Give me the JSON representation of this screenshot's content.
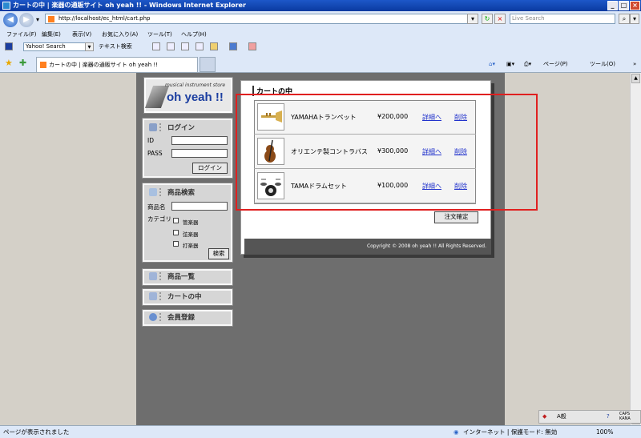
{
  "window": {
    "title": "カートの中 | 楽器の通販サイト oh yeah !! - Windows Internet Explorer",
    "minimize": "_",
    "maximize": "□",
    "close": "×"
  },
  "address_bar": {
    "url": "http://localhost/ec_html/cart.php",
    "search_placeholder": "Live Search"
  },
  "menu": {
    "file": "ファイル(F)",
    "edit": "編集(E)",
    "view": "表示(V)",
    "favorites": "お気に入り(A)",
    "tools": "ツール(T)",
    "help": "ヘルプ(H)"
  },
  "toolbar": {
    "yahoo_search": "Yahoo! Search",
    "text_search": "テキスト検索"
  },
  "tab": {
    "label": "カートの中 | 楽器の通販サイト oh yeah !!"
  },
  "command_bar": {
    "page": "ページ(P)",
    "tools": "ツール(O)"
  },
  "site": {
    "logo_sub": "musical instrument store",
    "logo_main": "oh yeah !!",
    "login": {
      "heading": "ログイン",
      "id_label": "ID",
      "pass_label": "PASS",
      "button": "ログイン"
    },
    "search": {
      "heading": "商品検索",
      "name_label": "商品名",
      "category_label": "カテゴリ",
      "categories": [
        "管楽器",
        "弦楽器",
        "打楽器"
      ],
      "button": "検索"
    },
    "nav": {
      "product_list": "商品一覧",
      "cart": "カートの中",
      "register": "会員登録"
    },
    "cart": {
      "title": "カートの中",
      "items": [
        {
          "name": "YAMAHAトランペット",
          "price": "¥200,000",
          "detail": "詳細へ",
          "delete": "削除",
          "icon": "trumpet-icon"
        },
        {
          "name": "オリエンテ製コントラバス",
          "price": "¥300,000",
          "detail": "詳細へ",
          "delete": "削除",
          "icon": "contrabass-icon"
        },
        {
          "name": "TAMAドラムセット",
          "price": "¥100,000",
          "detail": "詳細へ",
          "delete": "削除",
          "icon": "drumset-icon"
        }
      ],
      "confirm_button": "注文確定"
    },
    "copyright": "Copyright © 2008 oh yeah !! All Rights Reserved."
  },
  "ime": {
    "mode": "A般",
    "caps": "CAPS",
    "kana": "KANA"
  },
  "status_bar": {
    "message": "ページが表示されました",
    "zone": "インターネット | 保護モード: 無効",
    "zoom": "100%"
  },
  "colors": {
    "highlight_box": "#e02020",
    "link": "#2233cc",
    "logo": "#1b3ea0"
  }
}
